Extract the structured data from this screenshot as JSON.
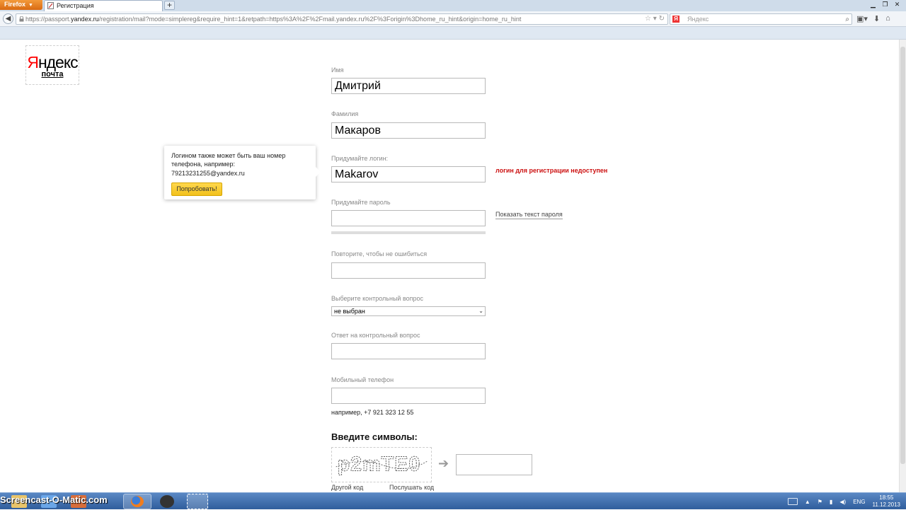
{
  "browser": {
    "menu_button": "Firefox",
    "tab_title": "Регистрация",
    "new_tab": "+",
    "url_prefix": "https://passport.",
    "url_domain": "yandex.ru",
    "url_rest": "/registration/mail?mode=simplereg&require_hint=1&retpath=https%3A%2F%2Fmail.yandex.ru%2F%3Forigin%3Dhome_ru_hint&origin=home_ru_hint",
    "search_placeholder": "Яндекс",
    "search_engine_glyph": "Я"
  },
  "logo": {
    "brand_red": "Я",
    "brand_rest": "ндекс",
    "product": "почта"
  },
  "form": {
    "name_label": "Имя",
    "name_value": "Дмитрий",
    "surname_label": "Фамилия",
    "surname_value": "Макаров",
    "login_label": "Придумайте логин:",
    "login_value": "Makarov",
    "login_error": "логин для регистрации недоступен",
    "password_label": "Придумайте пароль",
    "show_password": "Показать текст пароля",
    "repeat_label": "Повторите, чтобы не ошибиться",
    "question_label": "Выберите контрольный вопрос",
    "question_selected": "не выбран",
    "answer_label": "Ответ на контрольный вопрос",
    "phone_label": "Мобильный телефон",
    "phone_hint": "например, +7 921 323 12 55"
  },
  "tooltip": {
    "text": "Логином также может быть ваш номер телефона, например:",
    "example": "79213231255@yandex.ru",
    "button": "Попробовать!"
  },
  "captcha": {
    "title": "Введите символы:",
    "image_text": "p2mTE0",
    "other_code": "Другой код",
    "listen_code": "Послушать код"
  },
  "taskbar": {
    "watermark": "Screencast-O-Matic.com",
    "language": "ENG",
    "time": "18:55",
    "date": "11.12.2013"
  },
  "colors": {
    "error": "#cc1111",
    "button_yellow": "#f2c11c",
    "taskbar": "#3f6fb0",
    "firefox_orange": "#e27b1c"
  }
}
